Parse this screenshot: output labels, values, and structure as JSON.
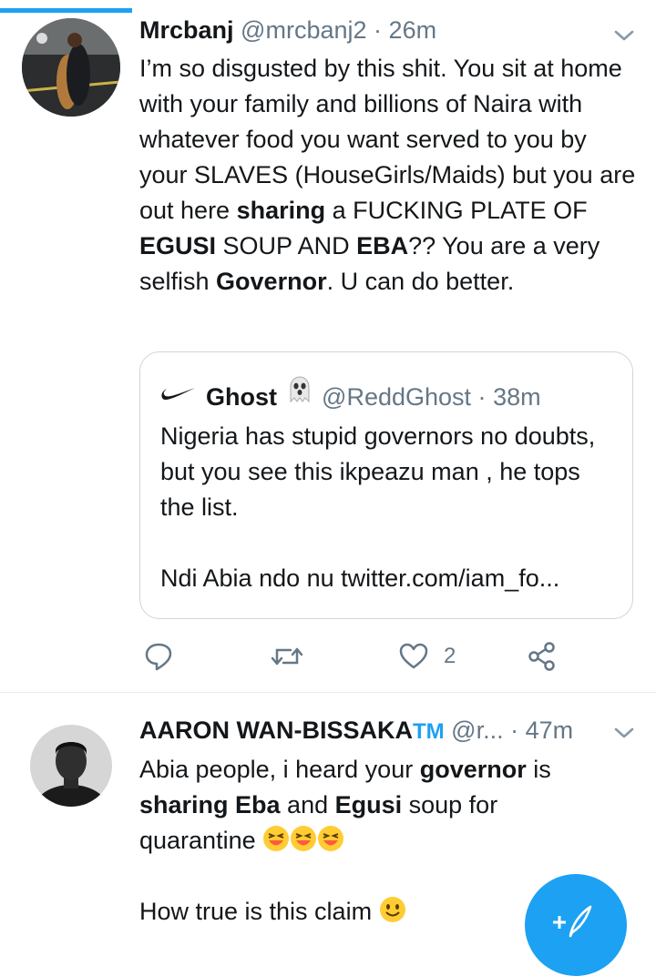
{
  "tweet1": {
    "name": "Mrcbanj",
    "handle": "@mrcbanj2",
    "dot": "·",
    "time": "26m",
    "text": {
      "p1": "I’m so disgusted by this shit. You sit at home with your family and billions of Naira with whatever food you want served to you by your SLAVES (HouseGirls/Maids) but you are out here ",
      "b1": "sharing",
      "p2": " a FUCKING PLATE OF ",
      "b2": "EGUSI",
      "p3": " SOUP AND ",
      "b3": "EBA",
      "p4": "?? You are a very selfish ",
      "b4": "Governor",
      "p5": ". U can do better."
    },
    "quote": {
      "name": "Ghost",
      "handle": "@ReddGhost",
      "dot": "·",
      "time": "38m",
      "line1": "Nigeria has stupid governors no doubts, but you see this ikpeazu man , he tops the list.",
      "line2": "Ndi Abia ndo nu twitter.com/iam_fo..."
    },
    "actions": {
      "like_count": "2"
    }
  },
  "tweet2": {
    "name": "AARON WAN-BISSAKA",
    "name_suffix": "TM",
    "handle": "@r...",
    "dot": "·",
    "time": "47m",
    "text": {
      "p1": "Abia people, i heard your ",
      "b1": "governor",
      "p2": " is ",
      "b2": "sharing Eba",
      "p3": " and ",
      "b3": "Egusi",
      "p4": " soup for quarantine ",
      "p5": "How true is this claim "
    }
  },
  "icons": {
    "chevron": "chevron-down-icon",
    "reply": "reply-icon",
    "retweet": "retweet-icon",
    "like": "heart-icon",
    "share": "share-icon",
    "compose": "compose-tweet-icon",
    "ghost_emoji": "ghost-emoji",
    "laugh_emoji": "grinning-squinting-face-emoji",
    "smile_emoji": "smiling-face-emoji",
    "nike": "nike-swoosh-icon"
  },
  "colors": {
    "accent": "#1da1f2",
    "secondary_text": "#657786",
    "border": "#ccd6dd"
  }
}
